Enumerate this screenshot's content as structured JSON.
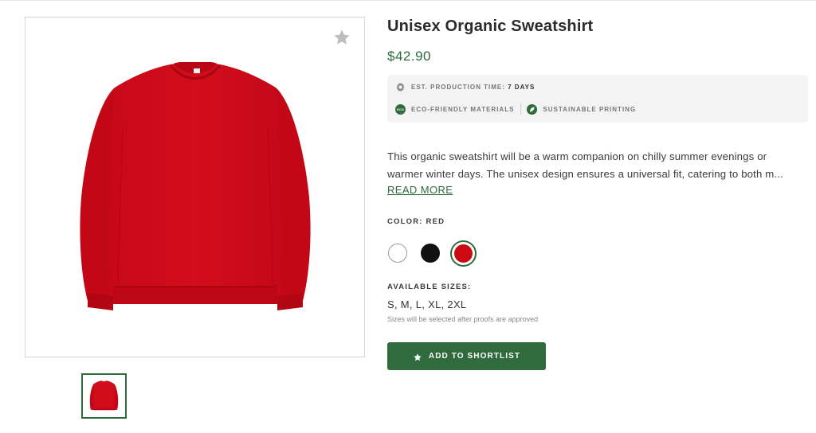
{
  "product": {
    "title": "Unisex Organic Sweatshirt",
    "price": "$42.90",
    "image_color": "#cc0a14"
  },
  "production": {
    "label": "EST. PRODUCTION TIME:",
    "value": "7 DAYS"
  },
  "badges": [
    {
      "icon": "eco-icon",
      "icon_text": "ECO",
      "label": "ECO-FRIENDLY MATERIALS"
    },
    {
      "icon": "leaf-icon",
      "label": "SUSTAINABLE PRINTING"
    }
  ],
  "description": {
    "line1": "This organic sweatshirt will be a warm companion on chilly summer evenings or",
    "line2": "warmer winter days. The unisex design ensures a universal fit, catering to both m...",
    "read_more": "READ MORE"
  },
  "color": {
    "label": "COLOR: RED",
    "options": [
      {
        "name": "White",
        "hex": "#ffffff"
      },
      {
        "name": "Black",
        "hex": "#111111"
      },
      {
        "name": "Red",
        "hex": "#cc0a14",
        "selected": true
      }
    ]
  },
  "sizes": {
    "label": "AVAILABLE SIZES:",
    "value": "S, M, L, XL, 2XL",
    "note": "Sizes will be selected after proofs are approved"
  },
  "actions": {
    "shortlist_label": "ADD TO SHORTLIST"
  },
  "theme": {
    "accent": "#2f6b3c"
  }
}
